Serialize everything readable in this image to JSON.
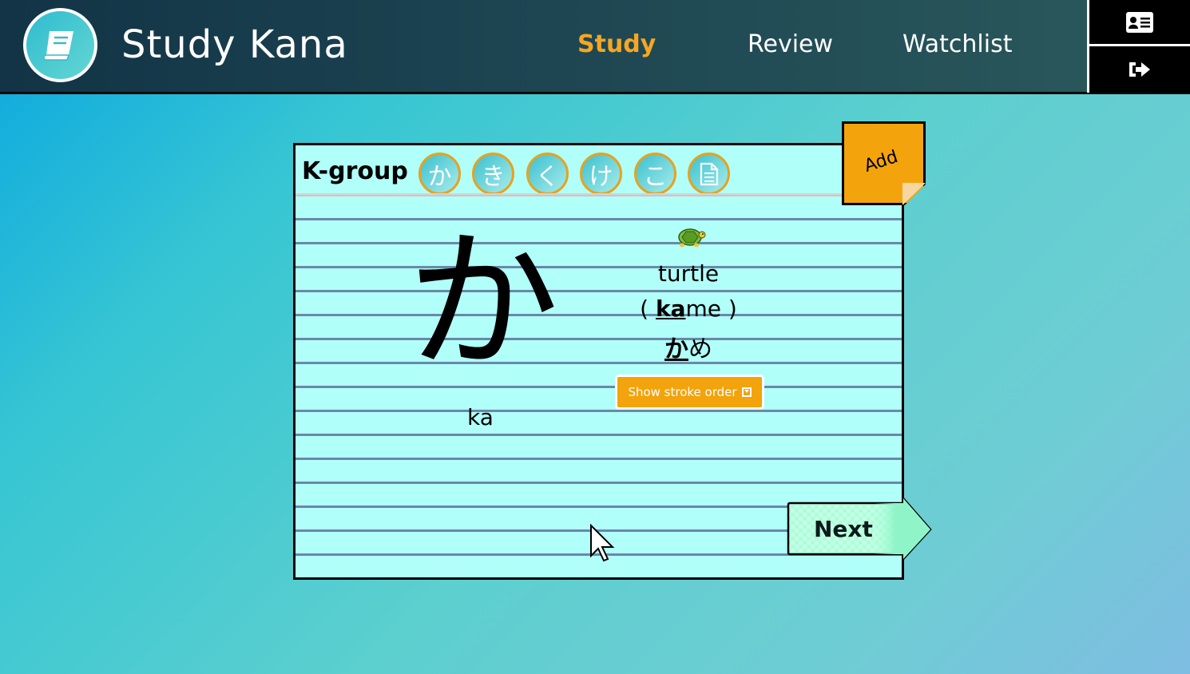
{
  "header": {
    "app_title": "Study Kana",
    "logo_icon": "book-icon",
    "nav": [
      {
        "label": "Study",
        "active": true
      },
      {
        "label": "Review",
        "active": false
      },
      {
        "label": "Watchlist",
        "active": false
      }
    ],
    "side_buttons": [
      {
        "icon": "profile-card-icon"
      },
      {
        "icon": "sign-out-icon"
      }
    ]
  },
  "card": {
    "group_title": "K-group",
    "kana_buttons": [
      "か",
      "き",
      "く",
      "け",
      "こ"
    ],
    "notes_icon": "document-icon",
    "main_kana": "か",
    "main_romaji": "ka",
    "word": {
      "icon": "turtle-icon",
      "english": "turtle",
      "romaji_open": "( ",
      "romaji_highlight": "ka",
      "romaji_rest": "me",
      "romaji_close": " )",
      "kana_highlight": "か",
      "kana_rest": "め"
    },
    "stroke_button_label": "Show stroke order",
    "add_label": "Add",
    "next_label": "Next"
  },
  "colors": {
    "accent": "#f3a40c",
    "card_bg": "#b1fff9",
    "nav_active": "#f5a623",
    "next_tab": "#aaffd9"
  }
}
